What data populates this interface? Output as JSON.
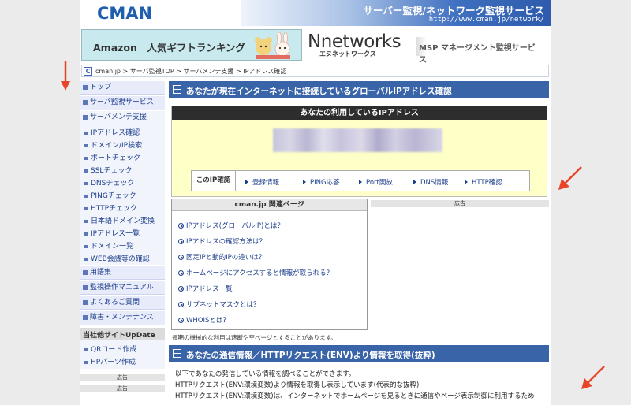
{
  "header": {
    "logo": "CMAN",
    "tagline": "サーバー監視/ネットワーク監視サービス",
    "url": "http://www.cman.jp/network/"
  },
  "ads": {
    "amazon": "Amazon　人気ギフトランキング",
    "nnetworks_logo": "Nnetworks",
    "nnetworks_kana": "エヌネットワークス",
    "msp": "MSP マネージメント監視サービス"
  },
  "breadcrumb": {
    "icon": "C",
    "text": "cman.jp > サーバ監視TOP > サーバメンテ支援 > IPアドレス確認"
  },
  "sidebar": {
    "top": "トップ",
    "server_monitor": "サーバ監視サービス",
    "maint": "サーバメンテ支援",
    "sub_items": [
      "IPアドレス確認",
      "ドメイン/IP検索",
      "ポートチェック",
      "SSLチェック",
      "DNSチェック",
      "PINGチェック",
      "HTTPチェック",
      "日本語ドメイン変換",
      "IPアドレス一覧",
      "ドメイン一覧",
      "WEB会議等の確認"
    ],
    "glossary": "用語集",
    "manual": "監視操作マニュアル",
    "faq": "よくあるご質問",
    "outage": "障害・メンテナンス",
    "sister_head": "当社他サイトUpDate",
    "sister_items": [
      "QRコード作成",
      "HPパーツ作成"
    ],
    "ad_label": "広告"
  },
  "main": {
    "section1_title": "あなたが現在インターネットに接続しているグローバルIPアドレス確認",
    "ip_box_title": "あなたの利用しているIPアドレス",
    "ip_check_label": "このIP確認",
    "ip_links": [
      "登録情報",
      "PING応答",
      "Port開放",
      "DNS情報",
      "HTTP確認"
    ],
    "related_title": "cman.jp 関連ページ",
    "related_links": [
      "IPアドレス(グローバルIP)とは？",
      "IPアドレスの確認方法は？",
      "固定IPと動的IPの違いは？",
      "ホームページにアクセスすると情報が取られる？",
      "IPアドレス一覧",
      "サブネットマスクとは？",
      "WHOISとは？"
    ],
    "ad_label": "広告",
    "note": "長期の機械的な利用は遮断や空ページとすることがあります。",
    "section2_title": "あなたの通信情報／HTTPリクエスト(ENV)より情報を取得(抜粋)",
    "info_lines": [
      "以下であなたの発信している情報を調べることができます。",
      "HTTPリクエスト(ENV:環境変数)より情報を取得し表示しています(代表的な抜粋)",
      "HTTPリクエスト(ENV:環境変数)は、インターネットでホームページを見るときに通信やページ表示制御に利用するため"
    ]
  }
}
